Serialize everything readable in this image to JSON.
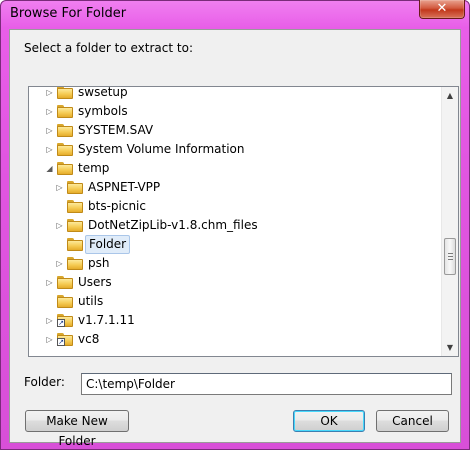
{
  "window": {
    "title": "Browse For Folder",
    "close_label": "✕"
  },
  "prompt": "Select a folder to extract to:",
  "tree": {
    "items": [
      {
        "label": "swsetup",
        "expander": "closed",
        "icon": "folder-icon"
      },
      {
        "label": "symbols",
        "expander": "closed",
        "icon": "folder-icon"
      },
      {
        "label": "SYSTEM.SAV",
        "expander": "closed",
        "icon": "folder-icon"
      },
      {
        "label": "System Volume Information",
        "expander": "closed",
        "icon": "folder-icon"
      },
      {
        "label": "temp",
        "expander": "open",
        "icon": "folder-icon"
      },
      {
        "label": "ASPNET-VPP",
        "expander": "closed",
        "icon": "folder-icon"
      },
      {
        "label": "bts-picnic",
        "expander": "none",
        "icon": "folder-icon"
      },
      {
        "label": "DotNetZipLib-v1.8.chm_files",
        "expander": "closed",
        "icon": "folder-icon"
      },
      {
        "label": "Folder",
        "expander": "none",
        "icon": "folder-icon",
        "selected": true
      },
      {
        "label": "psh",
        "expander": "closed",
        "icon": "folder-icon"
      },
      {
        "label": "Users",
        "expander": "closed",
        "icon": "folder-icon"
      },
      {
        "label": "utils",
        "expander": "none",
        "icon": "folder-icon"
      },
      {
        "label": "v1.7.1.11",
        "expander": "closed",
        "icon": "folder-shortcut-icon"
      },
      {
        "label": "vc8",
        "expander": "closed",
        "icon": "folder-shortcut-icon"
      }
    ]
  },
  "scrollbar": {
    "up": "▲",
    "down": "▼"
  },
  "folder_field": {
    "label": "Folder:",
    "value": "C:\\temp\\Folder"
  },
  "buttons": {
    "new_folder": "Make New Folder",
    "ok": "OK",
    "cancel": "Cancel"
  },
  "colors": {
    "frame": "#e055e0",
    "selection": "#e0ecf9",
    "close": "#c2381c"
  }
}
